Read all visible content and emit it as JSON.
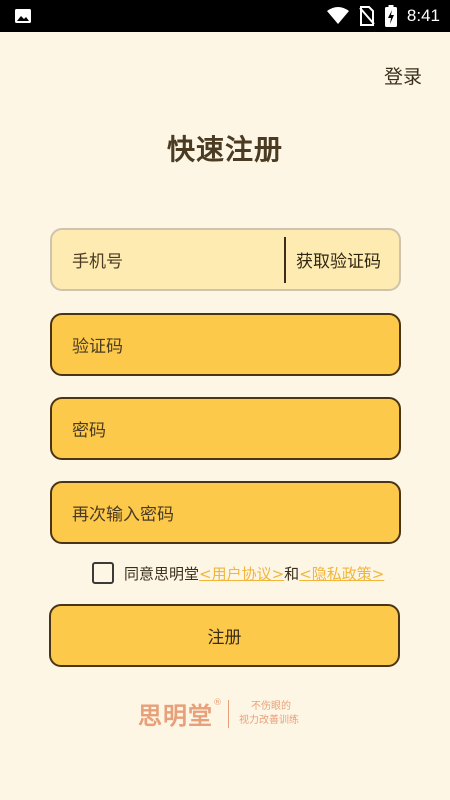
{
  "status_bar": {
    "time": "8:41",
    "icons": [
      "image-icon",
      "wifi-icon",
      "no-sim-icon",
      "battery-charging-icon"
    ]
  },
  "header": {
    "login_label": "登录",
    "title": "快速注册"
  },
  "form": {
    "phone_placeholder": "手机号",
    "get_code_label": "获取验证码",
    "code_placeholder": "验证码",
    "password_placeholder": "密码",
    "confirm_password_placeholder": "再次输入密码"
  },
  "agreement": {
    "checked": false,
    "prefix": "同意思明堂",
    "user_agreement": "<用户协议>",
    "and": "和",
    "privacy_policy": "<隐私政策>"
  },
  "register_label": "注册",
  "brand": {
    "name": "思明堂",
    "reg_mark": "®",
    "slogan_line1": "不伤眼的",
    "slogan_line2": "视力改善训练"
  },
  "colors": {
    "background": "#fdf6e4",
    "input_yellow": "#fdc94a",
    "phone_field": "#fdebb1",
    "link": "#f2b53a",
    "brand": "#e8a07a"
  }
}
